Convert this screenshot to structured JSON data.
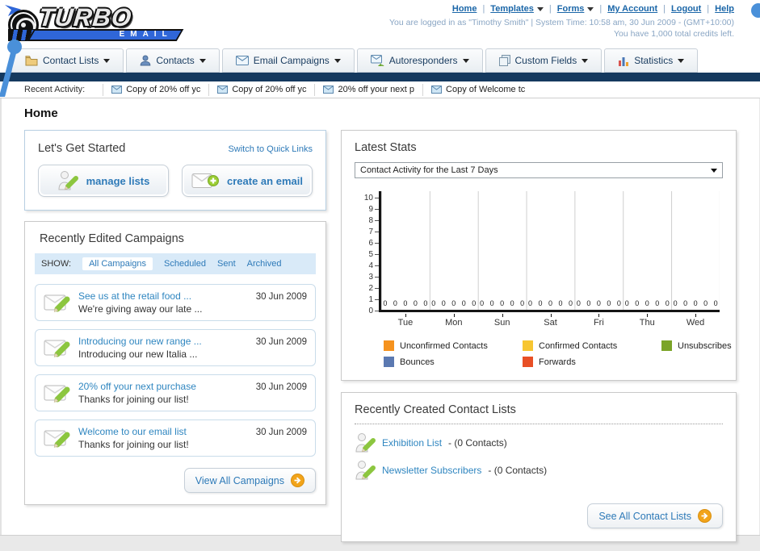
{
  "accent_colors": {
    "link_blue": "#2e7ab8",
    "navy_bar": "#15395e",
    "pin_blue": "#4a90d9",
    "button_orange": "#f2a41a",
    "logo_blue": "#2f66d8"
  },
  "header": {
    "logo_line1": "TURBO",
    "logo_line2": "EMAIL",
    "nav": [
      {
        "label": "Home"
      },
      {
        "label": "Templates"
      },
      {
        "label": "Forms"
      },
      {
        "label": "My Account"
      },
      {
        "label": "Logout"
      },
      {
        "label": "Help"
      }
    ],
    "session_line": "You are logged in as \"Timothy Smith\" | System Time: 10:58 am, 30 Jun 2009 - (GMT+10:00)",
    "credits_line": "You have 1,000 total credits left."
  },
  "tabs": [
    {
      "label": "Contact Lists",
      "icon": "folder-icon"
    },
    {
      "label": "Contacts",
      "icon": "person-icon"
    },
    {
      "label": "Email Campaigns",
      "icon": "envelope-icon"
    },
    {
      "label": "Autoresponders",
      "icon": "envelope-reply-icon"
    },
    {
      "label": "Custom Fields",
      "icon": "pages-icon"
    },
    {
      "label": "Statistics",
      "icon": "bar-chart-icon"
    }
  ],
  "activity_bar": {
    "label": "Recent Activity:",
    "items": [
      "Copy of 20% off yc",
      "Copy of 20% off yc",
      "20% off your next p",
      "Copy of Welcome tc"
    ]
  },
  "page_title": "Home",
  "get_started": {
    "title": "Let's Get Started",
    "switch_link": "Switch to Quick Links",
    "manage_lists_label": "manage lists",
    "create_email_label": "create an email"
  },
  "campaigns": {
    "title": "Recently Edited Campaigns",
    "show_label": "SHOW:",
    "filters": [
      "All Campaigns",
      "Scheduled",
      "Sent",
      "Archived"
    ],
    "active_filter": "All Campaigns",
    "items": [
      {
        "title": "See us at the retail food ...",
        "subtitle": "We're giving away our late ...",
        "date": "30 Jun 2009"
      },
      {
        "title": "Introducing our new range ...",
        "subtitle": "Introducing our new Italia ...",
        "date": "30 Jun 2009"
      },
      {
        "title": "20% off your next purchase",
        "subtitle": "Thanks for joining our list!",
        "date": "30 Jun 2009"
      },
      {
        "title": "Welcome to our email list",
        "subtitle": "Thanks for joining our list!",
        "date": "30 Jun 2009"
      }
    ],
    "view_all_label": "View All Campaigns"
  },
  "stats": {
    "title": "Latest Stats",
    "dropdown_value": "Contact Activity for the Last 7 Days",
    "zero_group": "0 0 0 0 0"
  },
  "chart_data": {
    "type": "bar",
    "title": "Contact Activity for the Last 7 Days",
    "categories": [
      "Tue",
      "Mon",
      "Sun",
      "Sat",
      "Fri",
      "Thu",
      "Wed"
    ],
    "series": [
      {
        "name": "Unconfirmed Contacts",
        "color": "#f5921e",
        "values": [
          0,
          0,
          0,
          0,
          0,
          0,
          0
        ]
      },
      {
        "name": "Confirmed Contacts",
        "color": "#f7c631",
        "values": [
          0,
          0,
          0,
          0,
          0,
          0,
          0
        ]
      },
      {
        "name": "Unsubscribes",
        "color": "#7ba428",
        "values": [
          0,
          0,
          0,
          0,
          0,
          0,
          0
        ]
      },
      {
        "name": "Bounces",
        "color": "#5b79b1",
        "values": [
          0,
          0,
          0,
          0,
          0,
          0,
          0
        ]
      },
      {
        "name": "Forwards",
        "color": "#e84f25",
        "values": [
          0,
          0,
          0,
          0,
          0,
          0,
          0
        ]
      }
    ],
    "xlabel": "",
    "ylabel": "",
    "ylim": [
      0,
      10
    ],
    "yticks": [
      "10",
      "9",
      "8",
      "7",
      "6",
      "5",
      "4",
      "3",
      "2",
      "1",
      "0"
    ],
    "grid": "vertical",
    "legend_position": "bottom",
    "data_labels": "each bar labeled 0"
  },
  "contact_lists": {
    "title": "Recently Created Contact Lists",
    "items": [
      {
        "name": "Exhibition List",
        "suffix": " - (0 Contacts)"
      },
      {
        "name": "Newsletter Subscribers",
        "suffix": " - (0 Contacts)"
      }
    ],
    "see_all_label": "See All Contact Lists"
  }
}
